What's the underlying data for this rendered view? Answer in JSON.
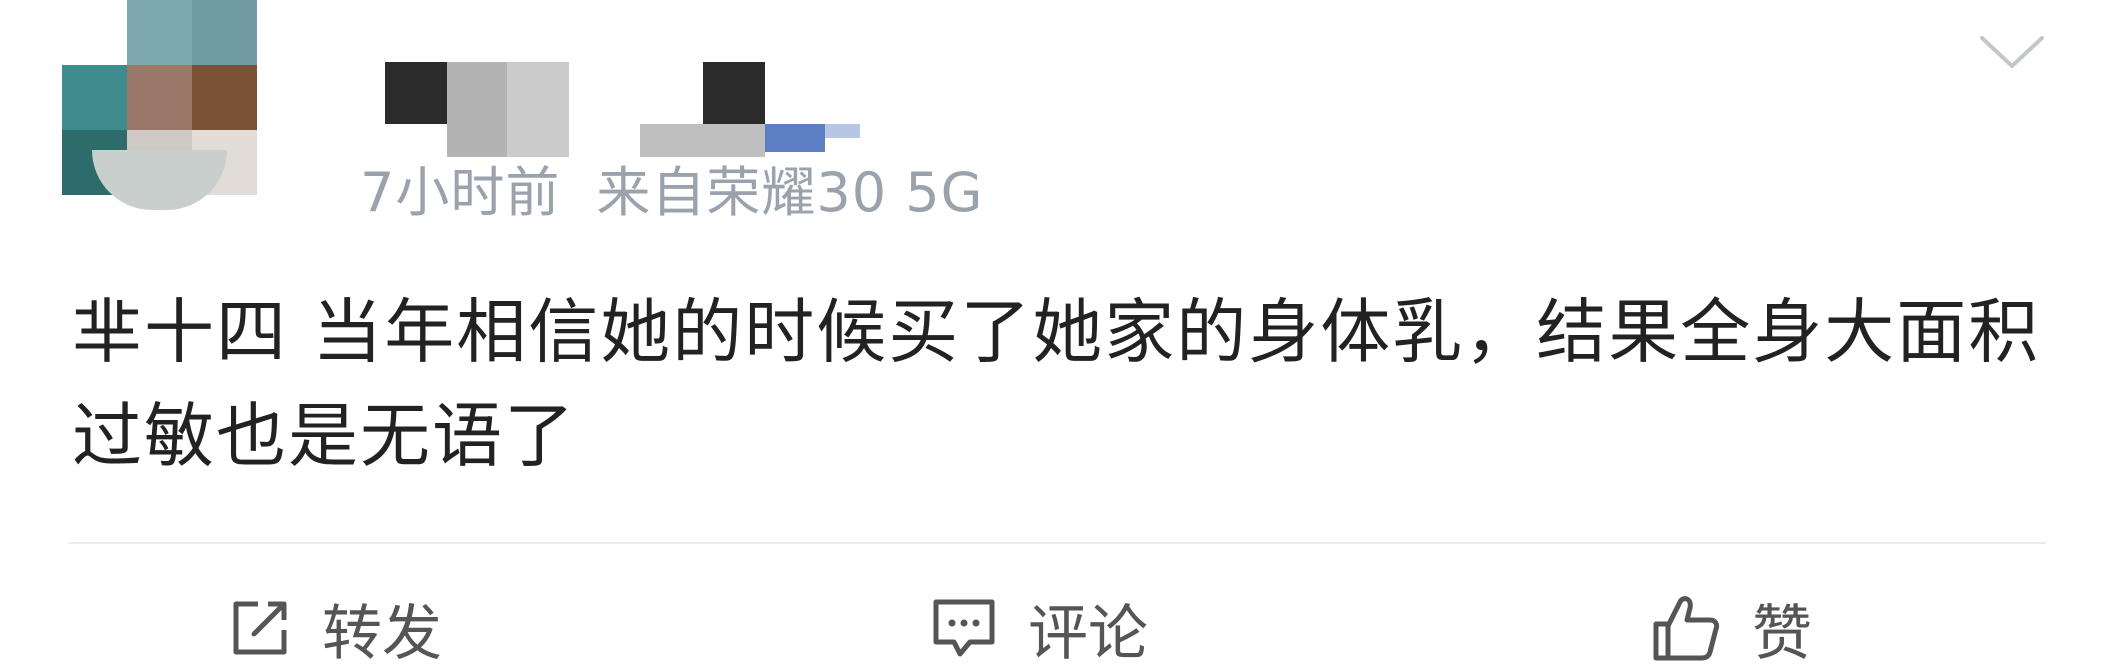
{
  "post": {
    "meta": {
      "time": "7小时前",
      "source": "来自荣耀30 5G"
    },
    "content": "芈十四  当年相信她的时候买了她家的身体乳，结果全身大面积过敏也是无语了",
    "actions": {
      "repost_label": "转发",
      "comment_label": "评论",
      "like_label": "赞"
    }
  },
  "colors": {
    "text": "#222222",
    "meta": "#9aa3ad",
    "action": "#555555",
    "divider": "#ececec"
  },
  "icons": [
    "avatar",
    "expand-chevron-icon",
    "repost-icon",
    "comment-icon",
    "like-icon"
  ]
}
